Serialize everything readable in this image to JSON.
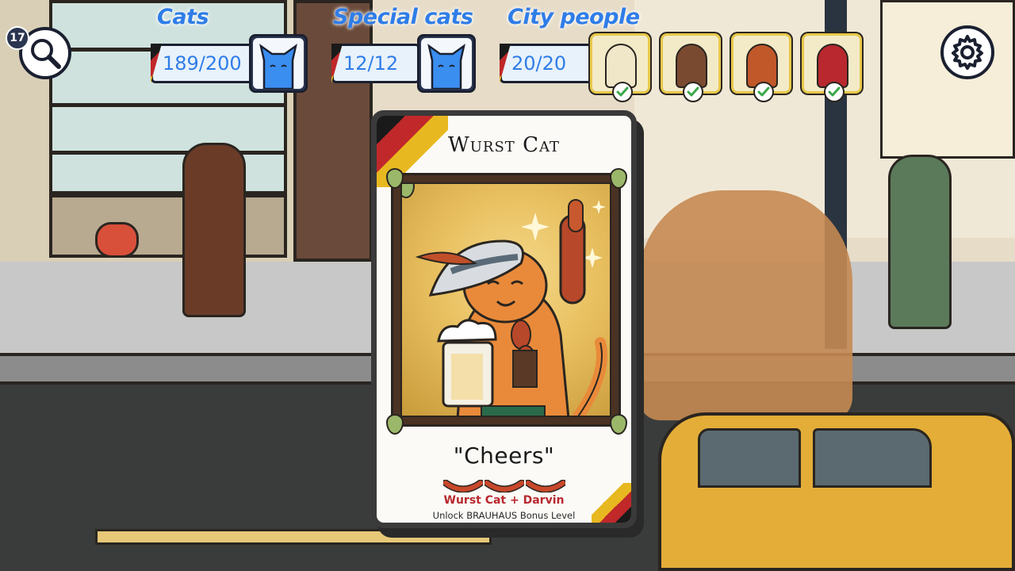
{
  "hud": {
    "cats": {
      "label": "Cats",
      "count": "189/200",
      "icon": "blue-cat-icon"
    },
    "special_cats": {
      "label": "Special cats",
      "count": "12/12",
      "icon": "blue-cat-icon"
    },
    "city_people": {
      "label": "City people",
      "count": "20/20",
      "people": [
        {
          "name": "city-person-1",
          "found": true,
          "color": "#f0e6c8"
        },
        {
          "name": "city-person-2",
          "found": true,
          "color": "#7a4a30"
        },
        {
          "name": "city-person-3",
          "found": true,
          "color": "#c0582a"
        },
        {
          "name": "city-person-4",
          "found": true,
          "color": "#b8282e"
        }
      ]
    },
    "search": {
      "icon": "magnifier-icon",
      "hint_count": "17"
    },
    "settings": {
      "icon": "gear-icon"
    }
  },
  "card": {
    "title": "Wurst Cat",
    "quote": "\"Cheers\"",
    "combo": "Wurst Cat + Darvin",
    "unlock": "Unlock BRAUHAUS Bonus Level",
    "sausage_count": 3
  },
  "colors": {
    "hud_blue": "#2f7de8",
    "check_green": "#3aa84a",
    "card_red": "#b8282e",
    "german_black": "#1a1a1a",
    "german_red": "#c0282a",
    "german_gold": "#e8b820"
  }
}
